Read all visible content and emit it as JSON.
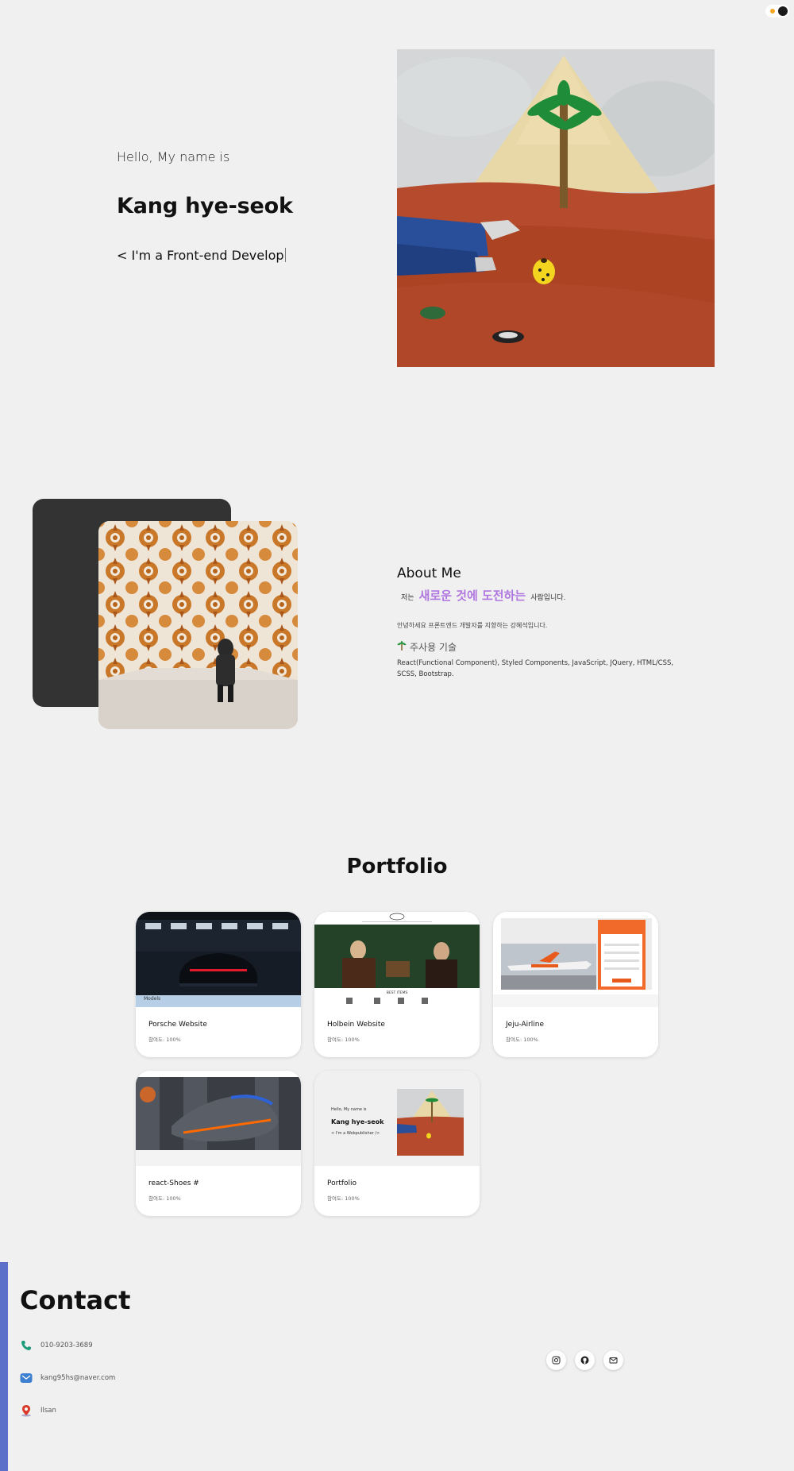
{
  "hero": {
    "greeting": "Hello, My name is",
    "name": "Kang hye-seok",
    "typing": "< I'm a Front-end Develop"
  },
  "about": {
    "title": "About Me",
    "tagline_prefix": "저는",
    "tagline_highlight": "새로운 것에 도전하는",
    "tagline_suffix": "사람입니다.",
    "intro": "안녕하세요 프론트엔드 개발자를 지향하는 강혜석입니다.",
    "skills_title": "주사용 기술",
    "skills": "React(Functional Component), Styled Components, JavaScript, JQuery, HTML/CSS, SCSS, Bootstrap."
  },
  "portfolio": {
    "title": "Portfolio",
    "cards": [
      {
        "title": "Porsche Website",
        "desc": "참여도: 100%",
        "thumb_caption": "Models"
      },
      {
        "title": "Holbein Website",
        "desc": "참여도: 100%",
        "thumb_caption": "BEST ITEMS"
      },
      {
        "title": "Jeju-Airline",
        "desc": "참여도: 100%",
        "thumb_caption": ""
      },
      {
        "title": "react-Shoes #",
        "desc": "참여도: 100%",
        "thumb_caption": ""
      },
      {
        "title": "Portfolio",
        "desc": "참여도: 100%",
        "thumb_caption": ""
      }
    ],
    "mini": {
      "greeting": "Hello, My name is",
      "name": "Kang hye-seok",
      "typing": "< I'm a Webpublisher />"
    }
  },
  "contact": {
    "title": "Contact",
    "phone": "010-9203-3689",
    "email": "kang95hs@naver.com",
    "location": "Ilsan",
    "icons": [
      "phone-icon",
      "mail-icon",
      "location-pin-icon"
    ],
    "social_icons": [
      "instagram-icon",
      "github-icon",
      "mail-icon"
    ]
  },
  "colors": {
    "background": "#f0f0f0",
    "highlight": "#b077e0",
    "contact_accent": "#5c70c9",
    "dark_card": "#333333"
  }
}
